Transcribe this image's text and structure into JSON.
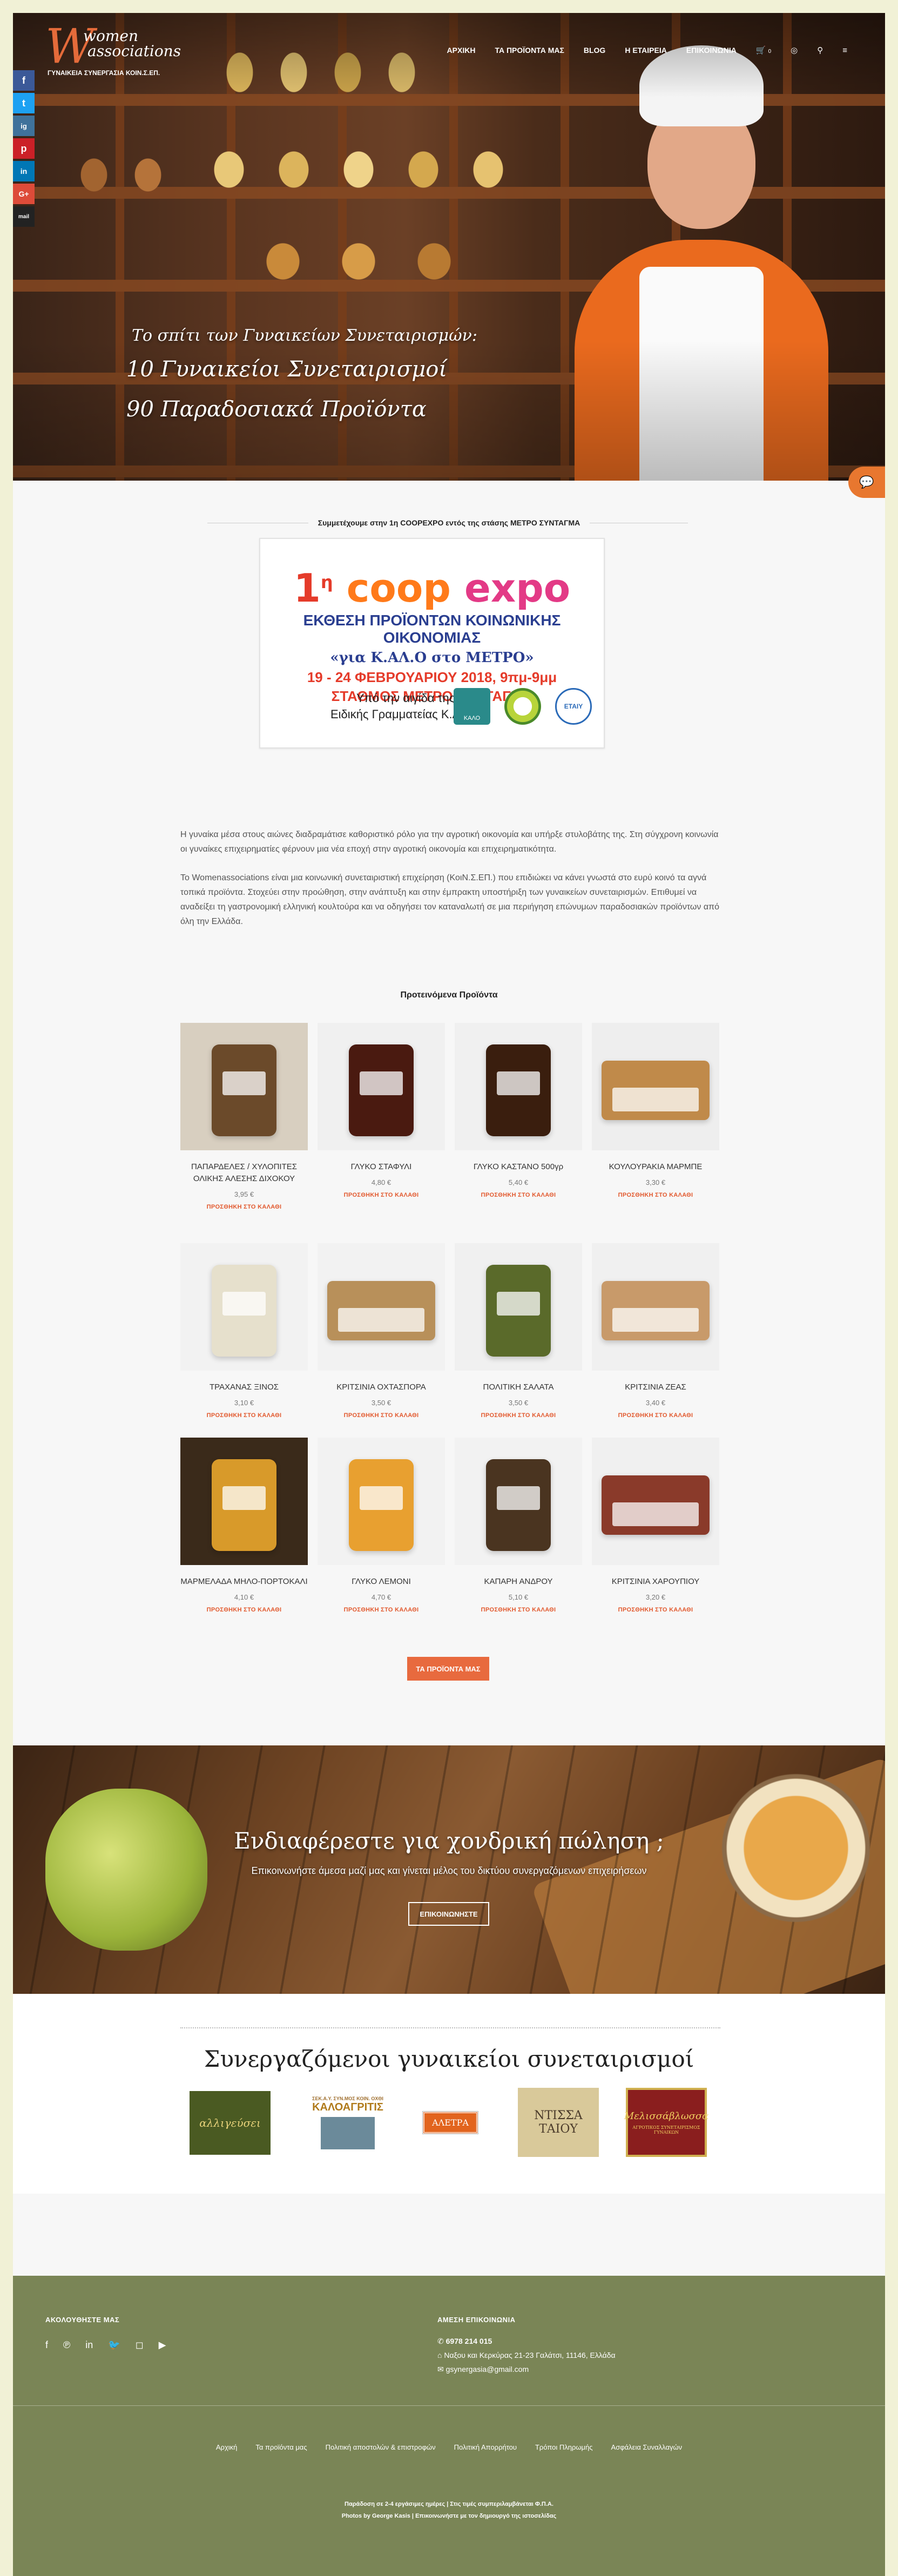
{
  "header": {
    "logo_word1": "women",
    "logo_word2": "associations",
    "logo_sub": "ΓΥΝΑΙΚΕΙΑ ΣΥΝΕΡΓΑΣΙΑ ΚΟΙΝ.Σ.ΕΠ.",
    "nav": [
      "ΑΡΧΙΚΗ",
      "ΤΑ ΠΡΟΪΟΝΤΑ ΜΑΣ",
      "BLOG",
      "Η ΕΤΑΙΡΕΙΑ",
      "ΕΠΙΚΟΙΝΩΝΙΑ"
    ],
    "cart_count": "0"
  },
  "hero": {
    "line1": "Το σπίτι των Γυναικείων Συνεταιρισμών:",
    "line2": "10 Γυναικείοι Συνεταιρισμοί",
    "line3": "90 Παραδοσιακά Προϊόντα"
  },
  "social_bar": [
    "f",
    "t",
    "ig",
    "p",
    "in",
    "G+",
    "mail"
  ],
  "announcement": {
    "title": "Συμμετέχουμε στην 1η COOPEXPO εντός της στάσης ΜΕΤΡΟ ΣΥΝΤΑΓΜΑ",
    "poster_logo_num": "1",
    "poster_logo_sup": "η",
    "poster_logo_word1": "coop",
    "poster_logo_word2": "expo",
    "poster_line1": "ΕΚΘΕΣΗ ΠΡΟΪΟΝΤΩΝ ΚΟΙΝΩΝΙΚΗΣ ΟΙΚΟΝΟΜΙΑΣ",
    "poster_line2": "«για Κ.ΑΛ.Ο στο ΜΕΤΡΟ»",
    "poster_line3": "19 - 24 ΦΕΒΡΟΥΑΡΙΟΥ 2018, 9πμ-9μμ",
    "poster_line4": "ΣΤΑΘΜΟΣ ΜΕΤΡΟ ΣΥΝΤΑΓΜΑ",
    "poster_line5": "Υπό την αιγίδα της",
    "poster_line6": "Ειδικής Γραμματείας Κ.ΑΛ.Ο",
    "poster_logo_a": "ΚΑΛΟ",
    "poster_logo_c": "ΕΤΑΙΥ"
  },
  "intro": {
    "p1": "Η γυναίκα μέσα στους αιώνες διαδραμάτισε καθοριστικό ρόλο για την αγροτική οικονομία και υπήρξε στυλοβάτης της. Στη σύγχρονη κοινωνία οι γυναίκες επιχειρηματίες φέρνουν μια νέα εποχή στην αγροτική οικονομία και επιχειρηματικότητα.",
    "p2": "Το Womenassociations είναι μια κοινωνική συνεταιριστική επιχείρηση (ΚοιΝ.Σ.ΕΠ.) που επιδιώκει να κάνει γνωστά στο ευρύ κοινό τα αγνά τοπικά προϊόντα. Στοχεύει στην προώθηση, στην ανάπτυξη και στην έμπρακτη υποστήριξη των γυναικείων συνεταιρισμών. Επιθυμεί να αναδείξει τη γαστρονομική ελληνική κουλτούρα και να οδηγήσει τον καταναλωτή σε μια περιήγηση επώνυμων παραδοσιακών προϊόντων από όλη την Ελλάδα."
  },
  "products": {
    "heading": "Προτεινόμενα Προϊόντα",
    "add_label": "ΠΡΟΣΘΗΚΗ ΣΤΟ ΚΑΛΑΘΙ",
    "items": [
      {
        "name": "ΠΑΠΑΡΔΕΛΕΣ / ΧΥΛΟΠΙΤΕΣ ΟΛΙΚΗΣ ΑΛΕΣΗΣ ΔΙΧΟΚΟΥ",
        "price": "3,95 €"
      },
      {
        "name": "ΓΛΥΚΟ ΣΤΑΦΥΛΙ",
        "price": "4,80 €"
      },
      {
        "name": "ΓΛΥΚΟ ΚΑΣΤΑΝΟ 500γρ",
        "price": "5,40 €"
      },
      {
        "name": "ΚΟΥΛΟΥΡΑΚΙΑ ΜΑΡΜΠΕ",
        "price": "3,30 €"
      },
      {
        "name": "ΤΡΑΧΑΝΑΣ ΞΙΝΟΣ",
        "price": "3,10 €"
      },
      {
        "name": "ΚΡΙΤΣΙΝΙΑ ΟΧΤΑΣΠΟΡΑ",
        "price": "3,50 €"
      },
      {
        "name": "ΠΟΛΙΤΙΚΗ ΣΑΛΑΤΑ",
        "price": "3,50 €"
      },
      {
        "name": "ΚΡΙΤΣΙΝΙΑ ΖΕΑΣ",
        "price": "3,40 €"
      },
      {
        "name": "ΜΑΡΜΕΛΑΔΑ ΜΗΛΟ-ΠΟΡΤΟΚΑΛΙ",
        "price": "4,10 €"
      },
      {
        "name": "ΓΛΥΚΟ ΛΕΜΟΝΙ",
        "price": "4,70 €"
      },
      {
        "name": "ΚΑΠΑΡΗ ΑΝΔΡΟΥ",
        "price": "5,10 €"
      },
      {
        "name": "ΚΡΙΤΣΙΝΙΑ ΧΑΡΟΥΠΙΟΥ",
        "price": "3,20 €"
      }
    ],
    "all_button": "ΤΑ ΠΡΟΪΟΝΤΑ ΜΑΣ"
  },
  "wholesale": {
    "title": "Ενδιαφέρεστε για χονδρική πώληση ;",
    "subtitle": "Επικοινωνήστε άμεσα μαζί μας και γίνεται μέλος του δικτύου συνεργαζόμενων επιχειρήσεων",
    "button": "ΕΠΙΚΟΙΝΩΝΗΣΤΕ"
  },
  "partners": {
    "title": "Συνεργαζόμενοι γυναικείοι συνεταιρισμοί",
    "logos": [
      "αλλιγεύσει",
      "ΚΑΛΟΑΓΡΙΤΙΣ",
      "ΑΛΕΤΡΑ",
      "ΝΤΙΣΣΑ ΤΑΙΟΥ",
      "Μελισσάβλωσσα"
    ],
    "logo_caption_2": "ΣΕΚ.Α.Υ. ΣΥΝ.ΜΟΣ ΚΟΙΝ. ΟΧΘΙ",
    "logo_caption_5": "ΑΓΡΟΤΙΚΟΣ ΣΥΝΕΤΑΙΡΙΣΜΟΣ ΓΥΝΑΙΚΩΝ"
  },
  "footer": {
    "follow_heading": "ΑΚΟΛΟΥΘΗΣΤΕ ΜΑΣ",
    "contact_heading": "ΑΜΕΣΗ ΕΠΙΚΟΙΝΩΝΙΑ",
    "phone": "6978 214 015",
    "address": "Ναξου και Κερκύρας 21-23 Γαλάτσι, 11146, Ελλάδα",
    "email": "gsynergasia@gmail.com",
    "links": [
      "Αρχική",
      "Τα προϊόντα μας",
      "Πολιτική αποστολών & επιστροφών",
      "Πολιτική Απορρήτου",
      "Τρόποι Πληρωμής",
      "Ασφάλεια Συναλλαγών"
    ],
    "copy1": "Παράδοση σε 2-4 εργάσιμες ημέρες | Στις τιμές συμπεριλαμβάνεται Φ.Π.Α.",
    "copy2": "Photos by George Kasis | Επικοινωνήστε με τον δημιουργό της ιστοσελίδας"
  },
  "colors": {
    "accent": "#e86a3e",
    "footer_bg": "#7a8556",
    "page_bg": "#f1f1d6"
  }
}
